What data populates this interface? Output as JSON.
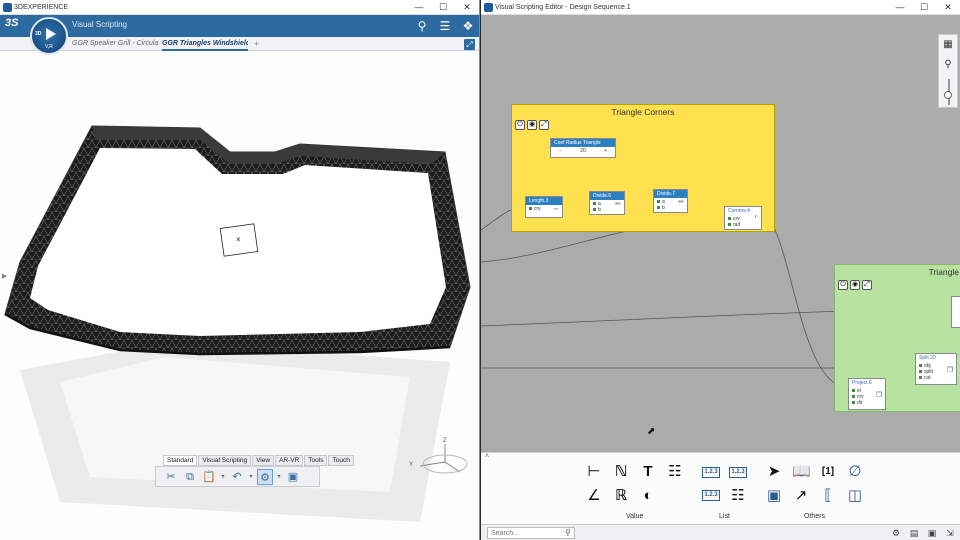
{
  "left_window": {
    "title": "3DEXPERIENCE",
    "app_name": "Visual Scripting",
    "compass": {
      "label_3d": "3D",
      "version": "V,R"
    },
    "tabs": [
      {
        "label": "GGR Speaker Grill - Circular",
        "active": false
      },
      {
        "label": "GGR Triangles Windshield",
        "active": true
      }
    ],
    "tab_add": "+",
    "axes": {
      "y": "Y",
      "z": "Z"
    },
    "toolbar_tabs": [
      "Standard",
      "Visual Scripting",
      "View",
      "AR-VR",
      "Tools",
      "Touch"
    ],
    "icons": [
      "search-icon",
      "menu-icon",
      "tag-icon",
      "expand-icon",
      "scissors-icon",
      "copy-icon",
      "paste-icon",
      "undo-icon",
      "update-icon",
      "graph-icon"
    ]
  },
  "right_window": {
    "title": "Visual Scripting Editor - Design Sequence.1",
    "groups": [
      {
        "title": "Triangle Corners",
        "color": "#ffe14f"
      },
      {
        "title": "Triangle",
        "color": "#b8e2a0"
      }
    ],
    "nodes": {
      "coef": {
        "title": "Coef Radius Triangle",
        "minus": "−",
        "value": "20",
        "plus": "+"
      },
      "length": {
        "title": "Length.3",
        "port": "crv"
      },
      "divide6": {
        "title": "Divide.6",
        "ports": [
          "a",
          "b"
        ]
      },
      "divide7": {
        "title": "Divide.7",
        "ports": [
          "a",
          "b"
        ]
      },
      "corners": {
        "title": "Corners.4",
        "ports": [
          "crv",
          "rad"
        ]
      },
      "project": {
        "title": "Project.6",
        "ports": [
          "el",
          "crv",
          "dir"
        ]
      },
      "split": {
        "title": "Split.20",
        "ports": [
          "obj",
          "split",
          "cut"
        ]
      }
    },
    "palette": {
      "sections": [
        "Value",
        "List",
        "Others"
      ],
      "list_labels": [
        "1.2.3",
        "1.2.3",
        "1.2.3"
      ],
      "other_labels": [
        "[1]"
      ]
    },
    "search": {
      "placeholder": "Search..."
    }
  }
}
